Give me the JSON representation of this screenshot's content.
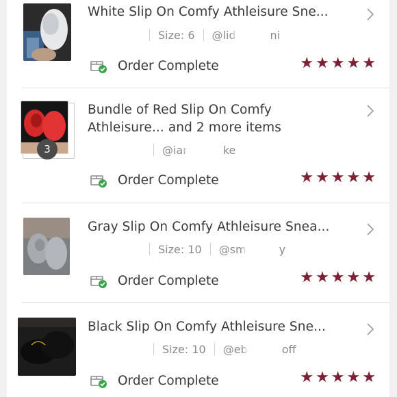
{
  "orders": [
    {
      "title": "White Slip On Comfy Athleisure Sne...",
      "size": "Size: 6",
      "seller": "@lid",
      "seller_tail": "ni",
      "status": "Order Complete",
      "rating": 5
    },
    {
      "title_line1": "Bundle of Red Slip On Comfy",
      "title_line2": "Athleisure... and 2 more items",
      "item_count": "3",
      "seller": "@iar",
      "seller_tail": "ke",
      "status": "Order Complete",
      "rating": 5
    },
    {
      "title": "Gray Slip On Comfy Athleisure Snea...",
      "size": "Size: 10",
      "seller": "@sm",
      "seller_tail": "y",
      "status": "Order Complete",
      "rating": 5
    },
    {
      "title": "Black Slip On Comfy Athleisure Sne...",
      "size": "Size: 10",
      "seller": "@eb",
      "seller_tail": "off",
      "status": "Order Complete",
      "rating": 5
    }
  ],
  "icons": {
    "status": "package-check-icon",
    "chevron": "chevron-right-icon",
    "star": "star-icon"
  },
  "colors": {
    "star": "#7d2033",
    "check": "#3aa64a"
  }
}
